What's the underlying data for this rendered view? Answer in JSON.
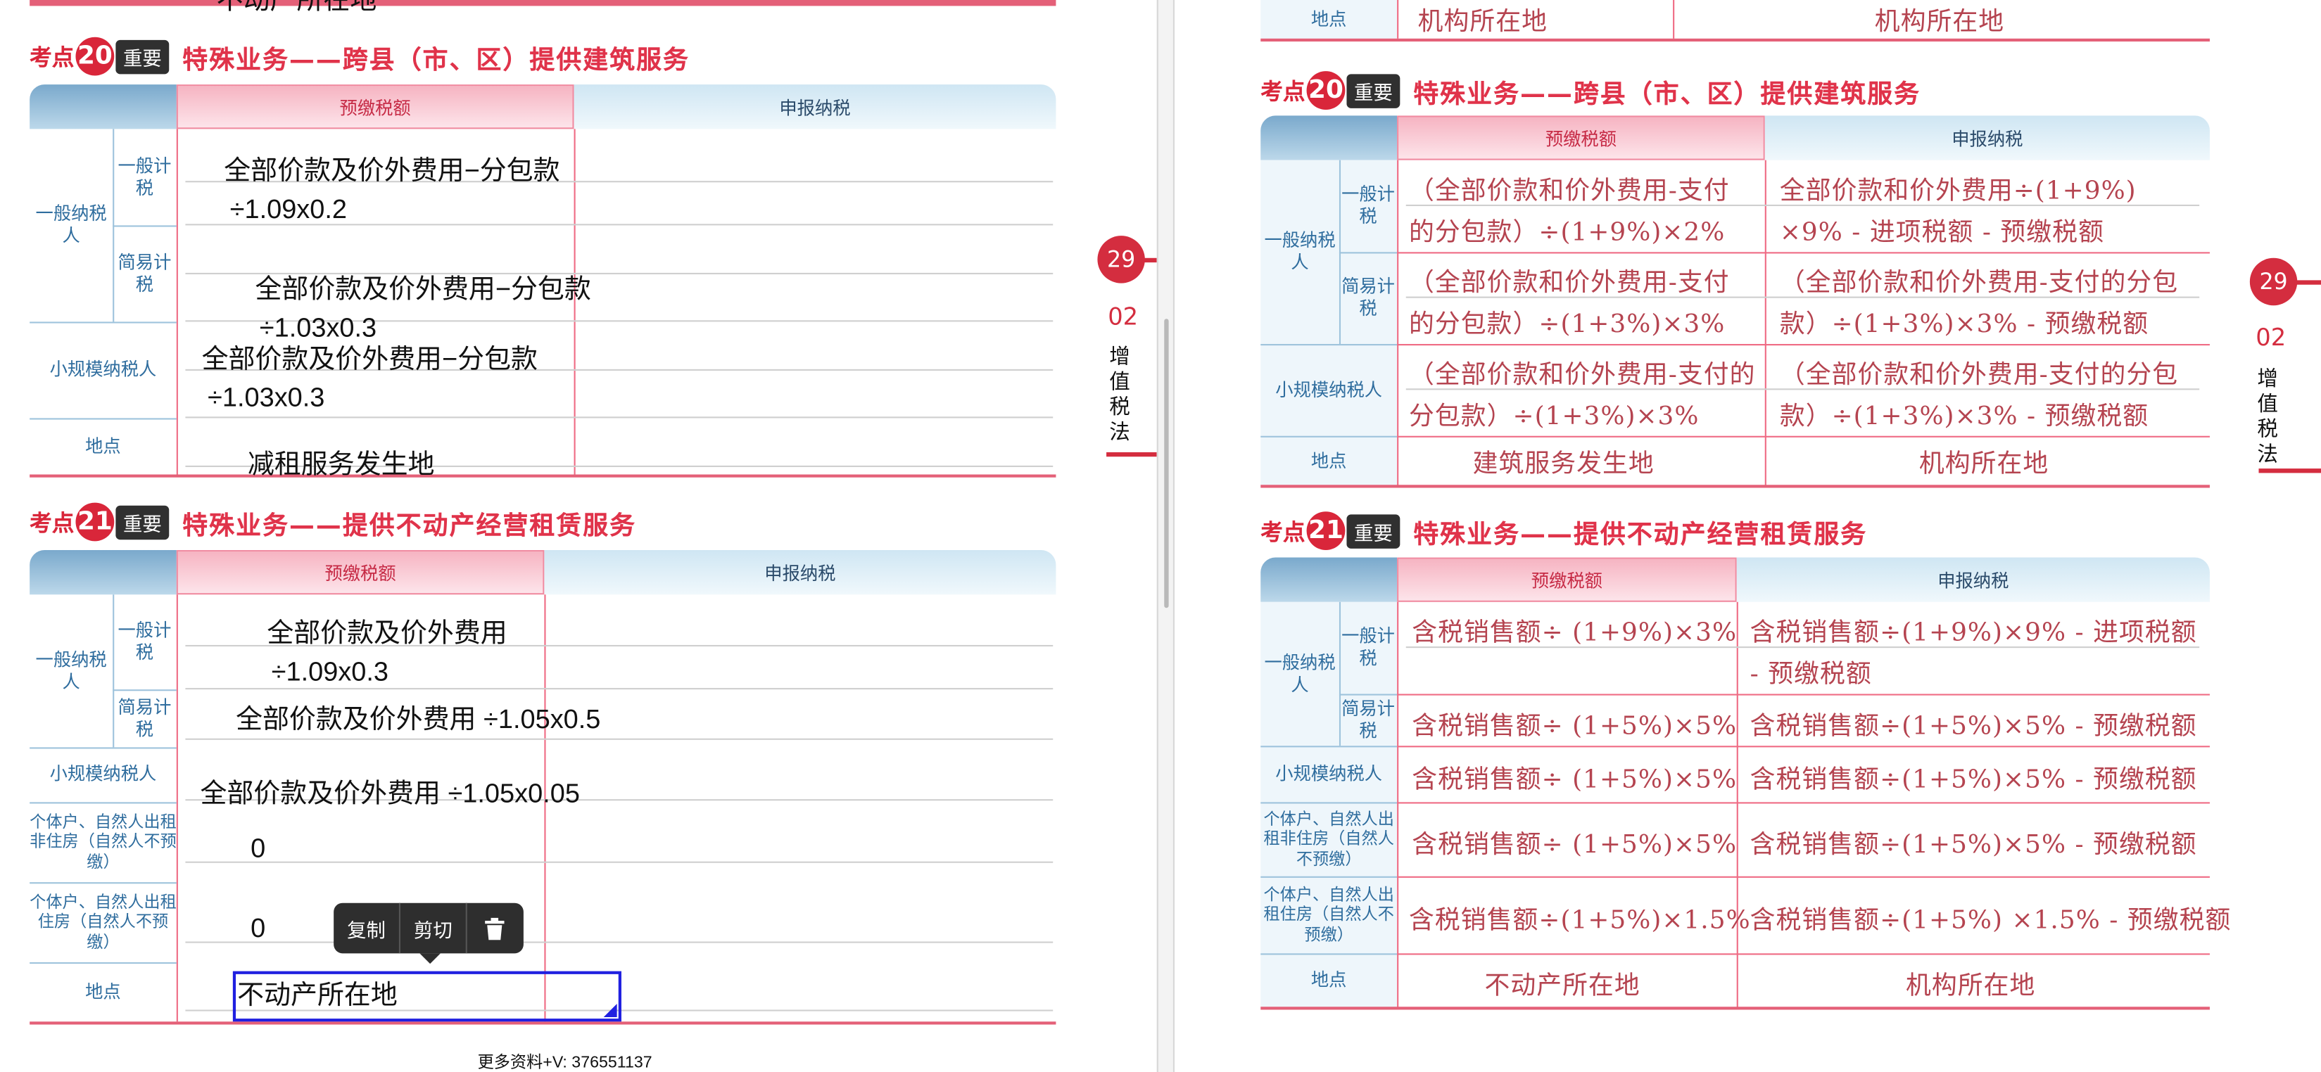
{
  "left": {
    "top_clipped_text": "不动产所在地",
    "sec20": {
      "badge_prefix": "考点",
      "badge_num": "20",
      "badge_tag": "重要",
      "title": "特殊业务——跨县（市、区）提供建筑服务",
      "col_prepay": "预缴税额",
      "col_declare": "申报纳税",
      "grp_general": "一般纳税人",
      "sub_general": "一般计税",
      "sub_simple": "简易计税",
      "small": "小规模纳税人",
      "loc": "地点",
      "r1_a": "全部价款及价外费用−分包款",
      "r1_b": "1.09x0.2",
      "r2_a": "全部价款及价外费用−分包款",
      "r2_b": "1.03x0.3",
      "r3_a": "全部价款及价外费用−分包款",
      "r3_b": "1.03x0.3",
      "r4": "减租服务发生地"
    },
    "sec21": {
      "badge_prefix": "考点",
      "badge_num": "21",
      "badge_tag": "重要",
      "title": "特殊业务——提供不动产经营租赁服务",
      "col_prepay": "预缴税额",
      "col_declare": "申报纳税",
      "grp_general": "一般纳税人",
      "sub_general": "一般计税",
      "sub_simple": "简易计税",
      "small": "小规模纳税人",
      "indiv_nonres": "个体户、自然人出租非住房（自然人不预缴）",
      "indiv_res": "个体户、自然人出租住房（自然人不预缴）",
      "loc": "地点",
      "r1_a": "全部价款及价外费用",
      "r1_b": "1.09x0.3",
      "r2_a": "全部价款及价外费用",
      "r2_b": "1.05x0.5",
      "r3_a": "全部价款及价外费用",
      "r3_b": "1.05x0.05",
      "r4": "0",
      "r5": "0",
      "r6": "不动产所在地"
    },
    "context_menu": {
      "copy": "复制",
      "cut": "剪切"
    },
    "divide_glyph": "÷",
    "footer": "更多资料+V:  376551137",
    "tab": {
      "page": "29",
      "chapter": "02",
      "chapter_name": "增值税法"
    }
  },
  "right": {
    "top_clipped": {
      "loc": "地点",
      "a": "机构所在地",
      "b": "机构所在地"
    },
    "sec20": {
      "badge_prefix": "考点",
      "badge_num": "20",
      "badge_tag": "重要",
      "title": "特殊业务——跨县（市、区）提供建筑服务",
      "col_prepay": "预缴税额",
      "col_declare": "申报纳税",
      "grp_general": "一般纳税人",
      "sub_general": "一般计税",
      "sub_simple": "简易计税",
      "small": "小规模纳税人",
      "loc": "地点",
      "r1_p1": "（全部价款和价外费用-支付",
      "r1_p2": "的分包款）÷(1+9%)×2%",
      "r1_d1": "全部价款和价外费用÷(1+9%)",
      "r1_d2": "×9% - 进项税额 - 预缴税额",
      "r2_p1": "（全部价款和价外费用-支付",
      "r2_p2": "的分包款）÷(1+3%)×3%",
      "r2_d1": "（全部价款和价外费用-支付的分包",
      "r2_d2": "款）÷(1+3%)×3% - 预缴税额",
      "r3_p1": "（全部价款和价外费用-支付的",
      "r3_p2": "分包款）÷(1+3%)×3%",
      "r3_d1": "（全部价款和价外费用-支付的分包",
      "r3_d2": "款）÷(1+3%)×3% - 预缴税额",
      "r4_p": "建筑服务发生地",
      "r4_d": "机构所在地"
    },
    "sec21": {
      "badge_prefix": "考点",
      "badge_num": "21",
      "badge_tag": "重要",
      "title": "特殊业务——提供不动产经营租赁服务",
      "col_prepay": "预缴税额",
      "col_declare": "申报纳税",
      "grp_general": "一般纳税人",
      "sub_general": "一般计税",
      "sub_simple": "简易计税",
      "small": "小规模纳税人",
      "indiv_nonres": "个体户、自然人出租非住房（自然人不预缴）",
      "indiv_res": "个体户、自然人出租住房（自然人不预缴）",
      "loc": "地点",
      "r1_p": "含税销售额÷ (1+9%)×3%",
      "r1_d1": "含税销售额÷(1+9%)×9% - 进项税额",
      "r1_d2": "- 预缴税额",
      "r2_p": "含税销售额÷ (1+5%)×5%",
      "r2_d": "含税销售额÷(1+5%)×5% - 预缴税额",
      "r3_p": "含税销售额÷ (1+5%)×5%",
      "r3_d": "含税销售额÷(1+5%)×5% - 预缴税额",
      "r4_p": "含税销售额÷ (1+5%)×5%",
      "r4_d": "含税销售额÷(1+5%)×5% - 预缴税额",
      "r5_p": "含税销售额÷(1+5%)×1.5%",
      "r5_d": "含税销售额÷(1+5%) ×1.5% - 预缴税额",
      "r6_p": "不动产所在地",
      "r6_d": "机构所在地"
    },
    "tab": {
      "page": "29",
      "chapter": "02",
      "chapter_name": "增值税法"
    }
  }
}
